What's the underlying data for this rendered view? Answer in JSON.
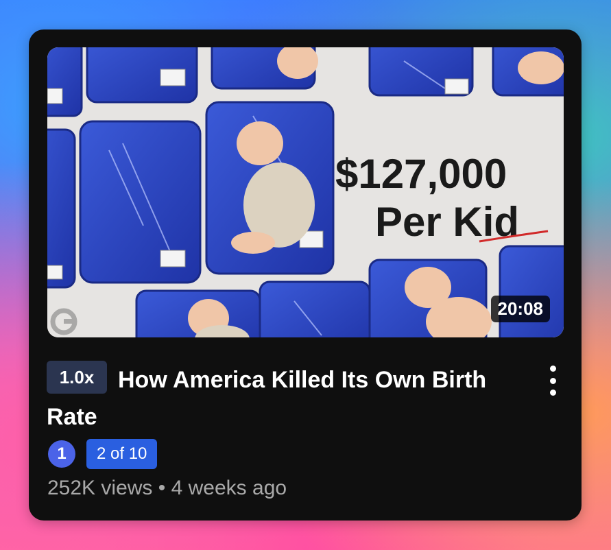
{
  "video": {
    "thumbnail_text_line1": "$127,000",
    "thumbnail_text_line2": "Per Kid",
    "duration": "20:08",
    "speed": "1.0x",
    "title": "How America Killed Its Own Birth Rate",
    "rank_number": "1",
    "playlist_position": "2 of 10",
    "views": "252K views",
    "separator": "•",
    "age": "4 weeks ago",
    "watermark_icon": "g-logo-icon",
    "menu_icon": "more-vert-icon"
  },
  "colors": {
    "card_bg": "#0f0f0f",
    "speed_badge_bg": "#2b3550",
    "playlist_badge_bg": "#2a5fe0",
    "rank_icon_bg": "#4b63e8",
    "meta_text": "#a9a9a9",
    "tray_blue": "#2f47c2"
  }
}
